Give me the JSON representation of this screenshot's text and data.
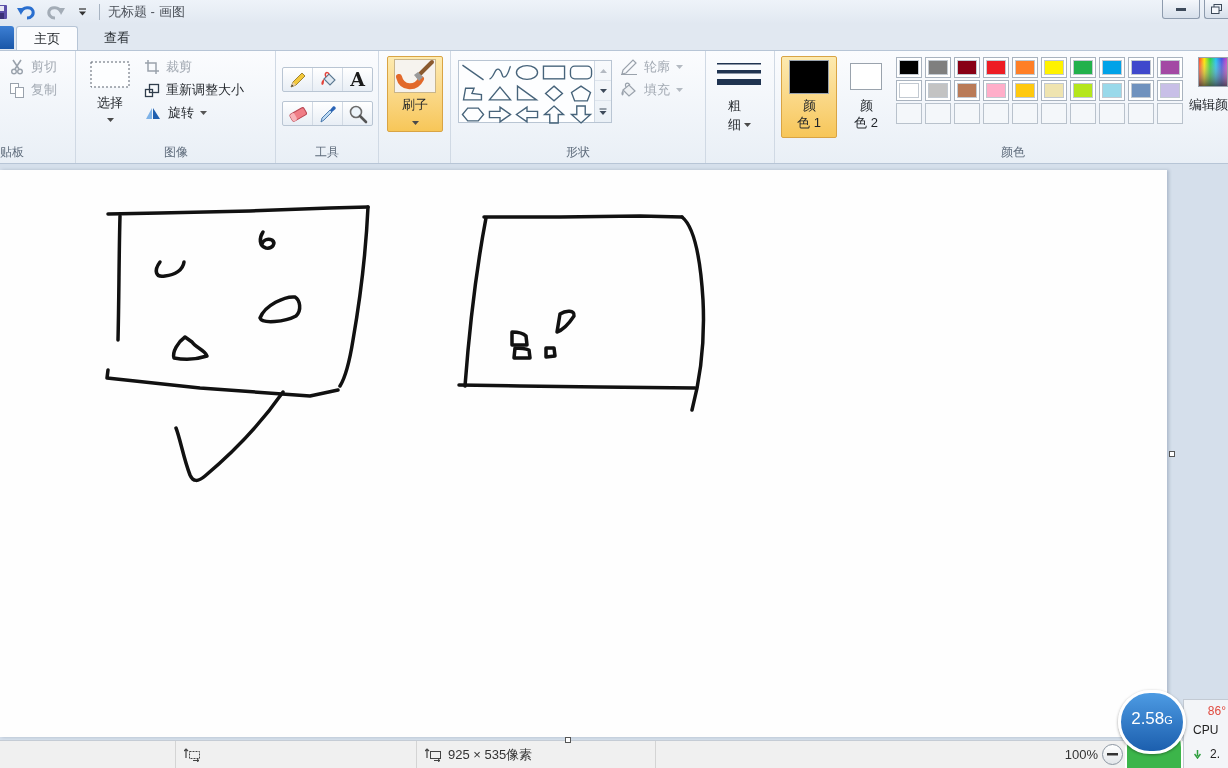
{
  "window": {
    "title": "无标题 - 画图"
  },
  "tabs": [
    {
      "label": "主页",
      "selected": true
    },
    {
      "label": "查看",
      "selected": false
    }
  ],
  "ribbon": {
    "clipboard": {
      "label": "贴板",
      "items": [
        {
          "kind": "cut",
          "label": "剪切",
          "disabled": true
        },
        {
          "kind": "copy",
          "label": "复制",
          "disabled": true
        }
      ]
    },
    "image": {
      "label": "图像",
      "select": {
        "label": "选择"
      },
      "items": [
        {
          "kind": "crop",
          "label": "裁剪",
          "disabled": true
        },
        {
          "kind": "resize",
          "label": "重新调整大小",
          "disabled": false
        },
        {
          "kind": "rotate",
          "label": "旋转",
          "disabled": false
        }
      ]
    },
    "tools": {
      "label": "工具",
      "items": [
        {
          "kind": "pencil"
        },
        {
          "kind": "fill"
        },
        {
          "kind": "text",
          "glyph": "A"
        },
        {
          "kind": "eraser"
        },
        {
          "kind": "picker"
        },
        {
          "kind": "magnifier"
        }
      ]
    },
    "brush": {
      "label": "刷子",
      "selected": true
    },
    "shapes": {
      "label": "形状",
      "items": [
        {
          "kind": "outline",
          "label": "轮廓",
          "disabled": true
        },
        {
          "kind": "fill",
          "label": "填充",
          "disabled": true
        }
      ]
    },
    "size": {
      "label": "粗细"
    },
    "colors": {
      "label": "颜色",
      "active": [
        {
          "label": "颜色 1",
          "color": "#000000",
          "selected": true
        },
        {
          "label": "颜色 2",
          "color": "#ffffff",
          "selected": false
        }
      ],
      "palette": [
        {
          "kind": "color",
          "color": "#000000"
        },
        {
          "kind": "color",
          "color": "#7f7f7f"
        },
        {
          "kind": "color",
          "color": "#880015"
        },
        {
          "kind": "color",
          "color": "#ed1c24"
        },
        {
          "kind": "color",
          "color": "#ff7f27"
        },
        {
          "kind": "color",
          "color": "#fff200"
        },
        {
          "kind": "color",
          "color": "#22b14c"
        },
        {
          "kind": "color",
          "color": "#00a2e8"
        },
        {
          "kind": "color",
          "color": "#3f48cc"
        },
        {
          "kind": "color",
          "color": "#a349a4"
        },
        {
          "kind": "color",
          "color": "#ffffff"
        },
        {
          "kind": "color",
          "color": "#c3c3c3"
        },
        {
          "kind": "color",
          "color": "#b97a57"
        },
        {
          "kind": "color",
          "color": "#ffaec9"
        },
        {
          "kind": "color",
          "color": "#ffc90e"
        },
        {
          "kind": "color",
          "color": "#efe4b0"
        },
        {
          "kind": "color",
          "color": "#b5e61d"
        },
        {
          "kind": "color",
          "color": "#99d9ea"
        },
        {
          "kind": "color",
          "color": "#7092be"
        },
        {
          "kind": "color",
          "color": "#c8bfe7"
        },
        {
          "kind": "empty"
        },
        {
          "kind": "empty"
        },
        {
          "kind": "empty"
        },
        {
          "kind": "empty"
        },
        {
          "kind": "empty"
        },
        {
          "kind": "empty"
        },
        {
          "kind": "empty"
        },
        {
          "kind": "empty"
        },
        {
          "kind": "empty"
        },
        {
          "kind": "empty"
        }
      ],
      "edit": {
        "label": "编辑颜"
      }
    }
  },
  "status_bar": {
    "canvas_size": "925 × 535像素",
    "zoom": "100%"
  },
  "monitor_widget": {
    "speed": "2.58",
    "unit": "G",
    "temperature": "86°",
    "label": "CPU",
    "reading": "2."
  }
}
